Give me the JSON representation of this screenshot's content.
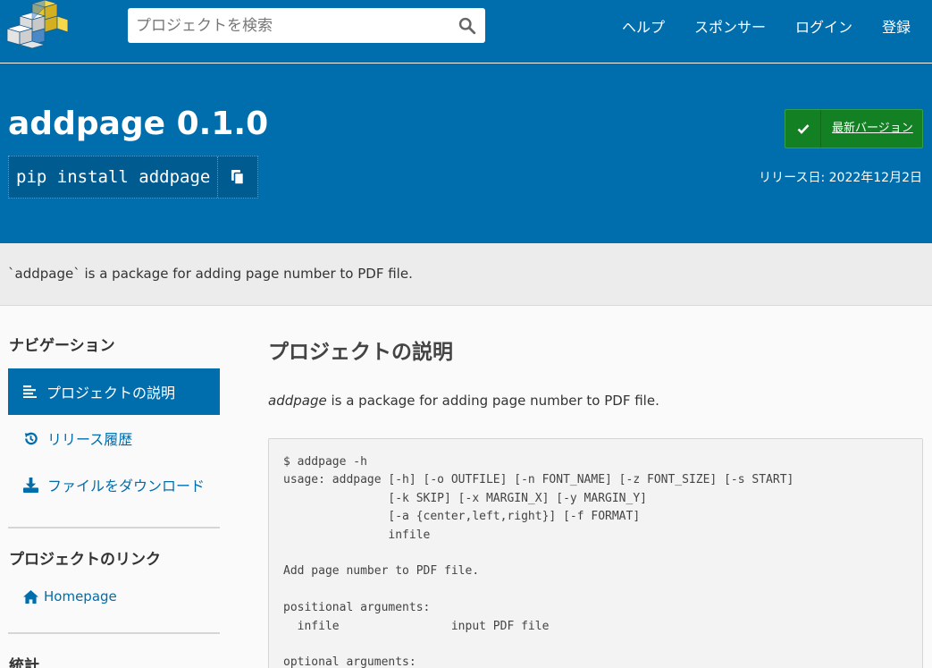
{
  "header": {
    "search_placeholder": "プロジェクトを検索",
    "nav": [
      "ヘルプ",
      "スポンサー",
      "ログイン",
      "登録"
    ]
  },
  "package": {
    "title": "addpage 0.1.0",
    "pip_command": "pip install addpage",
    "latest_label": "最新バージョン",
    "release_date": "リリース日: 2022年12月2日"
  },
  "summary": "`addpage` is a package for adding page number to PDF file.",
  "sidebar": {
    "nav_heading": "ナビゲーション",
    "items": [
      "プロジェクトの説明",
      "リリース履歴",
      "ファイルをダウンロード"
    ],
    "links_heading": "プロジェクトのリンク",
    "homepage": "Homepage",
    "stats_heading": "統計"
  },
  "main": {
    "heading": "プロジェクトの説明",
    "desc_em": "addpage",
    "desc_rest": " is a package for adding page number to PDF file.",
    "code": "$ addpage -h\nusage: addpage [-h] [-o OUTFILE] [-n FONT_NAME] [-z FONT_SIZE] [-s START]\n               [-k SKIP] [-x MARGIN_X] [-y MARGIN_Y]\n               [-a {center,left,right}] [-f FORMAT]\n               infile\n\nAdd page number to PDF file.\n\npositional arguments:\n  infile                input PDF file\n\noptional arguments:"
  },
  "colors": {
    "brand": "#006dad",
    "latest": "#148024"
  }
}
